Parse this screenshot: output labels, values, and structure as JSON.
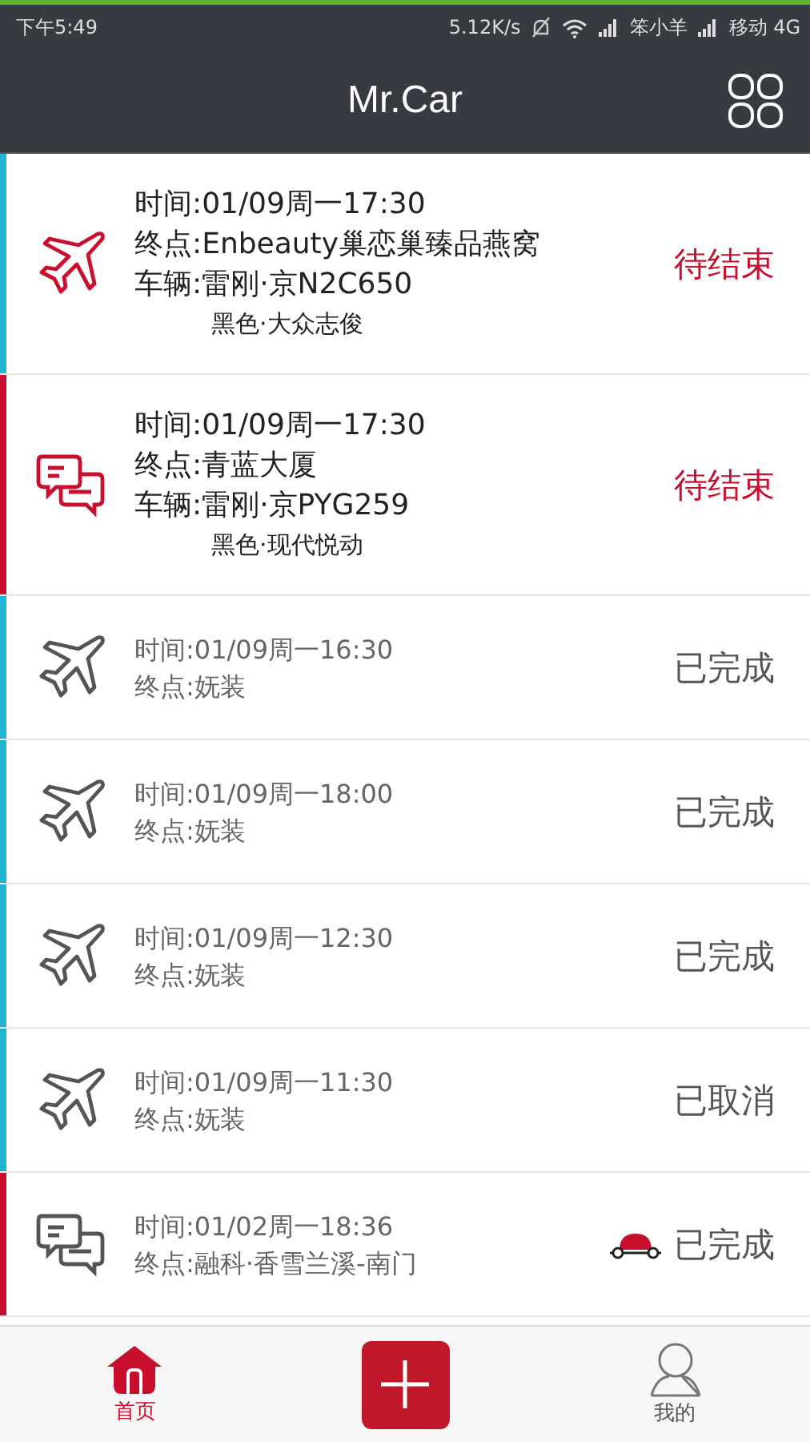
{
  "status_bar": {
    "time": "下午5:49",
    "speed": "5.12K/s",
    "carrier_1": "笨小羊",
    "carrier_2": "移动 4G"
  },
  "header": {
    "title": "Mr.Car"
  },
  "orders": [
    {
      "kind": "plane",
      "color": "#1eb4d2",
      "active": true,
      "time": "时间:01/09周一17:30",
      "destination": "终点:Enbeauty巢恋巢臻品燕窝",
      "vehicle": "车辆:雷刚·京N2C650",
      "vehicle_detail": "黑色·大众志俊",
      "status": "待结束",
      "car_badge": false
    },
    {
      "kind": "chat",
      "color": "#c8102e",
      "active": true,
      "time": "时间:01/09周一17:30",
      "destination": "终点:青蓝大厦",
      "vehicle": "车辆:雷刚·京PYG259",
      "vehicle_detail": "黑色·现代悦动",
      "status": "待结束",
      "car_badge": false
    },
    {
      "kind": "plane",
      "color": "#1eb4d2",
      "active": false,
      "time": "时间:01/09周一16:30",
      "destination": "终点:妩装",
      "status": "已完成",
      "car_badge": false
    },
    {
      "kind": "plane",
      "color": "#1eb4d2",
      "active": false,
      "time": "时间:01/09周一18:00",
      "destination": "终点:妩装",
      "status": "已完成",
      "car_badge": false
    },
    {
      "kind": "plane",
      "color": "#1eb4d2",
      "active": false,
      "time": "时间:01/09周一12:30",
      "destination": "终点:妩装",
      "status": "已完成",
      "car_badge": false
    },
    {
      "kind": "plane",
      "color": "#1eb4d2",
      "active": false,
      "time": "时间:01/09周一11:30",
      "destination": "终点:妩装",
      "status": "已取消",
      "car_badge": false
    },
    {
      "kind": "chat",
      "color": "#c8102e",
      "active": false,
      "time": "时间:01/02周一18:36",
      "destination": "终点:融科·香雪兰溪-南门",
      "status": "已完成",
      "car_badge": true
    }
  ],
  "nav": [
    {
      "kind": "home",
      "label": "首页",
      "selected": true
    },
    {
      "kind": "add",
      "selected": false
    },
    {
      "kind": "me",
      "label": "我的",
      "selected": false
    }
  ]
}
